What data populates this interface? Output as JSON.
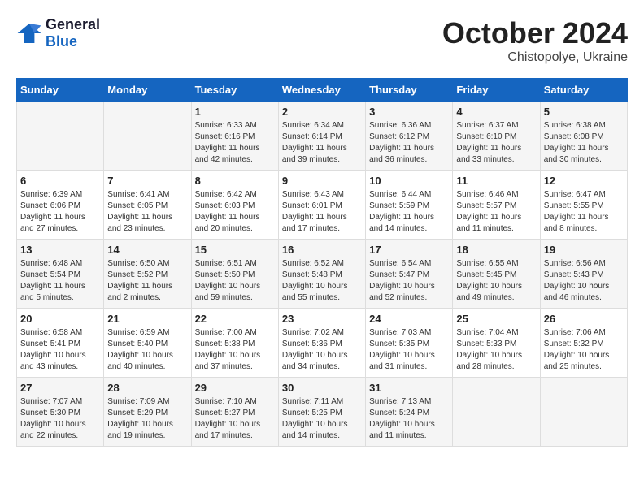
{
  "logo": {
    "line1": "General",
    "line2": "Blue"
  },
  "title": "October 2024",
  "location": "Chistopolye, Ukraine",
  "headers": [
    "Sunday",
    "Monday",
    "Tuesday",
    "Wednesday",
    "Thursday",
    "Friday",
    "Saturday"
  ],
  "weeks": [
    [
      {
        "day": "",
        "info": ""
      },
      {
        "day": "",
        "info": ""
      },
      {
        "day": "1",
        "info": "Sunrise: 6:33 AM\nSunset: 6:16 PM\nDaylight: 11 hours and 42 minutes."
      },
      {
        "day": "2",
        "info": "Sunrise: 6:34 AM\nSunset: 6:14 PM\nDaylight: 11 hours and 39 minutes."
      },
      {
        "day": "3",
        "info": "Sunrise: 6:36 AM\nSunset: 6:12 PM\nDaylight: 11 hours and 36 minutes."
      },
      {
        "day": "4",
        "info": "Sunrise: 6:37 AM\nSunset: 6:10 PM\nDaylight: 11 hours and 33 minutes."
      },
      {
        "day": "5",
        "info": "Sunrise: 6:38 AM\nSunset: 6:08 PM\nDaylight: 11 hours and 30 minutes."
      }
    ],
    [
      {
        "day": "6",
        "info": "Sunrise: 6:39 AM\nSunset: 6:06 PM\nDaylight: 11 hours and 27 minutes."
      },
      {
        "day": "7",
        "info": "Sunrise: 6:41 AM\nSunset: 6:05 PM\nDaylight: 11 hours and 23 minutes."
      },
      {
        "day": "8",
        "info": "Sunrise: 6:42 AM\nSunset: 6:03 PM\nDaylight: 11 hours and 20 minutes."
      },
      {
        "day": "9",
        "info": "Sunrise: 6:43 AM\nSunset: 6:01 PM\nDaylight: 11 hours and 17 minutes."
      },
      {
        "day": "10",
        "info": "Sunrise: 6:44 AM\nSunset: 5:59 PM\nDaylight: 11 hours and 14 minutes."
      },
      {
        "day": "11",
        "info": "Sunrise: 6:46 AM\nSunset: 5:57 PM\nDaylight: 11 hours and 11 minutes."
      },
      {
        "day": "12",
        "info": "Sunrise: 6:47 AM\nSunset: 5:55 PM\nDaylight: 11 hours and 8 minutes."
      }
    ],
    [
      {
        "day": "13",
        "info": "Sunrise: 6:48 AM\nSunset: 5:54 PM\nDaylight: 11 hours and 5 minutes."
      },
      {
        "day": "14",
        "info": "Sunrise: 6:50 AM\nSunset: 5:52 PM\nDaylight: 11 hours and 2 minutes."
      },
      {
        "day": "15",
        "info": "Sunrise: 6:51 AM\nSunset: 5:50 PM\nDaylight: 10 hours and 59 minutes."
      },
      {
        "day": "16",
        "info": "Sunrise: 6:52 AM\nSunset: 5:48 PM\nDaylight: 10 hours and 55 minutes."
      },
      {
        "day": "17",
        "info": "Sunrise: 6:54 AM\nSunset: 5:47 PM\nDaylight: 10 hours and 52 minutes."
      },
      {
        "day": "18",
        "info": "Sunrise: 6:55 AM\nSunset: 5:45 PM\nDaylight: 10 hours and 49 minutes."
      },
      {
        "day": "19",
        "info": "Sunrise: 6:56 AM\nSunset: 5:43 PM\nDaylight: 10 hours and 46 minutes."
      }
    ],
    [
      {
        "day": "20",
        "info": "Sunrise: 6:58 AM\nSunset: 5:41 PM\nDaylight: 10 hours and 43 minutes."
      },
      {
        "day": "21",
        "info": "Sunrise: 6:59 AM\nSunset: 5:40 PM\nDaylight: 10 hours and 40 minutes."
      },
      {
        "day": "22",
        "info": "Sunrise: 7:00 AM\nSunset: 5:38 PM\nDaylight: 10 hours and 37 minutes."
      },
      {
        "day": "23",
        "info": "Sunrise: 7:02 AM\nSunset: 5:36 PM\nDaylight: 10 hours and 34 minutes."
      },
      {
        "day": "24",
        "info": "Sunrise: 7:03 AM\nSunset: 5:35 PM\nDaylight: 10 hours and 31 minutes."
      },
      {
        "day": "25",
        "info": "Sunrise: 7:04 AM\nSunset: 5:33 PM\nDaylight: 10 hours and 28 minutes."
      },
      {
        "day": "26",
        "info": "Sunrise: 7:06 AM\nSunset: 5:32 PM\nDaylight: 10 hours and 25 minutes."
      }
    ],
    [
      {
        "day": "27",
        "info": "Sunrise: 7:07 AM\nSunset: 5:30 PM\nDaylight: 10 hours and 22 minutes."
      },
      {
        "day": "28",
        "info": "Sunrise: 7:09 AM\nSunset: 5:29 PM\nDaylight: 10 hours and 19 minutes."
      },
      {
        "day": "29",
        "info": "Sunrise: 7:10 AM\nSunset: 5:27 PM\nDaylight: 10 hours and 17 minutes."
      },
      {
        "day": "30",
        "info": "Sunrise: 7:11 AM\nSunset: 5:25 PM\nDaylight: 10 hours and 14 minutes."
      },
      {
        "day": "31",
        "info": "Sunrise: 7:13 AM\nSunset: 5:24 PM\nDaylight: 10 hours and 11 minutes."
      },
      {
        "day": "",
        "info": ""
      },
      {
        "day": "",
        "info": ""
      }
    ]
  ]
}
